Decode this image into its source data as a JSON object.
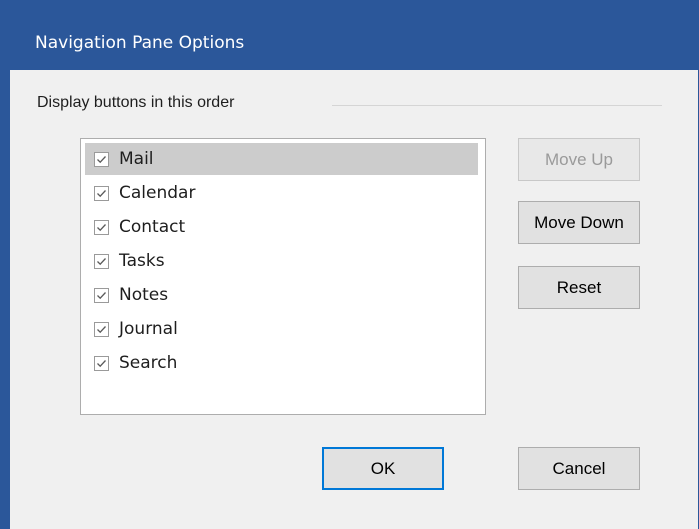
{
  "window": {
    "title": "Navigation Pane Options"
  },
  "group": {
    "label": "Display buttons in this order"
  },
  "list": {
    "items": [
      {
        "label": "Mail",
        "checked": true,
        "selected": true
      },
      {
        "label": "Calendar",
        "checked": true,
        "selected": false
      },
      {
        "label": "Contact",
        "checked": true,
        "selected": false
      },
      {
        "label": "Tasks",
        "checked": true,
        "selected": false
      },
      {
        "label": "Notes",
        "checked": true,
        "selected": false
      },
      {
        "label": "Journal",
        "checked": true,
        "selected": false
      },
      {
        "label": "Search",
        "checked": true,
        "selected": false
      }
    ]
  },
  "buttons": {
    "move_up": "Move Up",
    "move_down": "Move Down",
    "reset": "Reset",
    "ok": "OK",
    "cancel": "Cancel"
  },
  "colors": {
    "title_bar": "#2b579a",
    "dialog_bg": "#f0f0f0",
    "selection": "#cccccc",
    "default_button_border": "#0078d7"
  }
}
